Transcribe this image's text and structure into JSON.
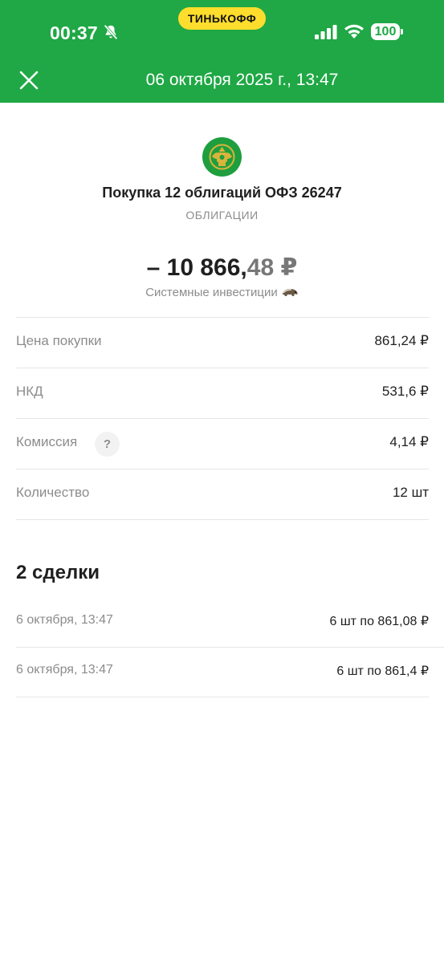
{
  "status_bar": {
    "time": "00:37",
    "brand": "ТИНЬКОФФ",
    "battery": "100"
  },
  "header": {
    "title": "06 октября 2025 г., 13:47"
  },
  "operation": {
    "title": "Покупка 12 облигаций ОФЗ 26247",
    "category": "ОБЛИГАЦИИ",
    "amount_main": "– 10 866,",
    "amount_frac": "48 ₽",
    "account": "Системные инвестиции"
  },
  "details": [
    {
      "label": "Цена покупки",
      "value": "861,24 ₽"
    },
    {
      "label": "НКД",
      "value": "531,6 ₽"
    },
    {
      "label": "Комиссия",
      "value": "4,14 ₽",
      "help": "?"
    },
    {
      "label": "Количество",
      "value": "12 шт"
    }
  ],
  "deals": {
    "title": "2 сделки",
    "items": [
      {
        "date": "6 октября, 13:47",
        "value": "6 шт по 861,08 ₽"
      },
      {
        "date": "6 октября, 13:47",
        "value": "6 шт по 861,4 ₽"
      }
    ]
  },
  "colors": {
    "header_green": "#1fa845",
    "brand_yellow": "#ffdd2d"
  }
}
